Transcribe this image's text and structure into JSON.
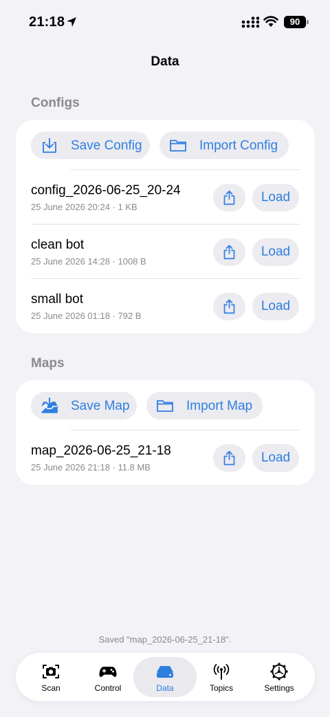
{
  "status_bar": {
    "time": "21:18",
    "battery": "90"
  },
  "nav": {
    "title": "Data"
  },
  "configs": {
    "header": "Configs",
    "save_label": "Save Config",
    "import_label": "Import Config",
    "items": [
      {
        "name": "config_2026-06-25_20-24",
        "meta": "25 June 2026  20:24  ·  1 KB",
        "load_label": "Load"
      },
      {
        "name": "clean bot",
        "meta": "25 June 2026  14:28  ·  1008 B",
        "load_label": "Load"
      },
      {
        "name": "small bot",
        "meta": "25 June 2026  01:18  ·  792 B",
        "load_label": "Load"
      }
    ]
  },
  "maps": {
    "header": "Maps",
    "save_label": "Save Map",
    "import_label": "Import Map",
    "items": [
      {
        "name": "map_2026-06-25_21-18",
        "meta": "25 June 2026  21:18  ·  11.8 MB",
        "load_label": "Load"
      }
    ]
  },
  "toast": "Saved \"map_2026-06-25_21-18\".",
  "tabs": [
    {
      "label": "Scan",
      "icon": "camera-icon",
      "active": false
    },
    {
      "label": "Control",
      "icon": "gamepad-icon",
      "active": false
    },
    {
      "label": "Data",
      "icon": "drive-icon",
      "active": true
    },
    {
      "label": "Topics",
      "icon": "antenna-icon",
      "active": false
    },
    {
      "label": "Settings",
      "icon": "gear-icon",
      "active": false
    }
  ],
  "colors": {
    "accent": "#2f7ee0",
    "background": "#f2f2f7",
    "card": "#ffffff",
    "button_fill": "#ebebf0",
    "secondary_text": "#8a8a8e"
  }
}
